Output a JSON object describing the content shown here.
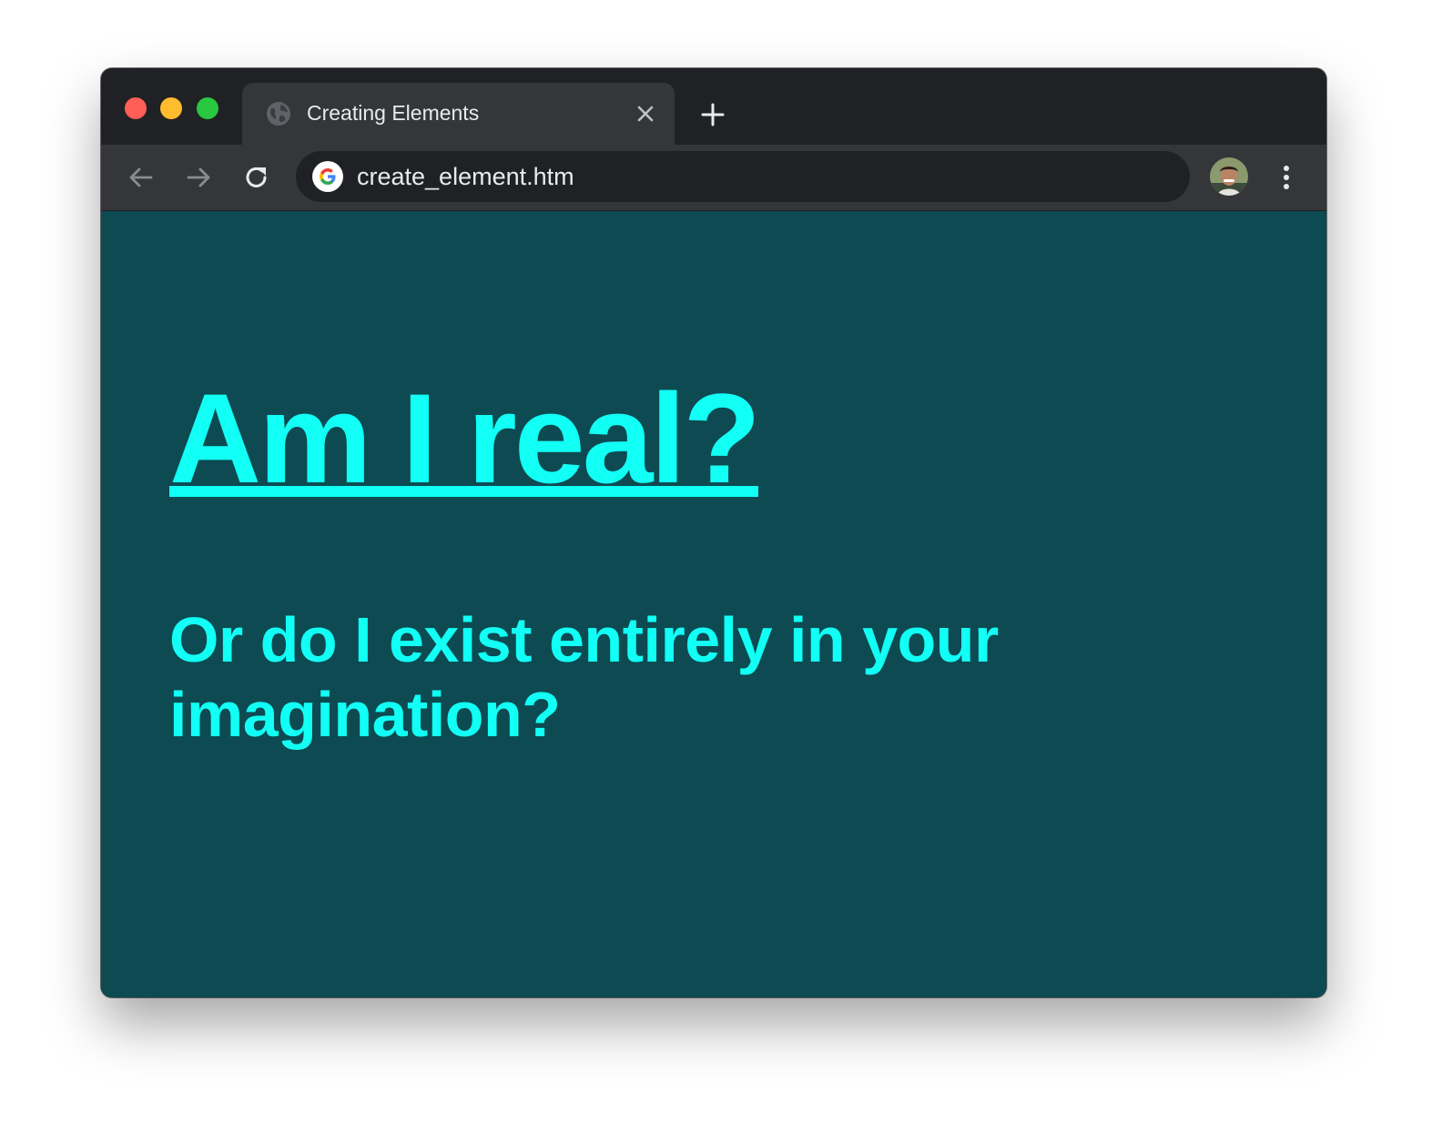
{
  "browser": {
    "tab": {
      "title": "Creating Elements",
      "favicon": "globe-icon"
    },
    "address_bar": {
      "url": "create_element.htm",
      "icon": "google-icon"
    },
    "icons": {
      "back": "arrow-left-icon",
      "forward": "arrow-right-icon",
      "reload": "reload-icon",
      "new_tab": "plus-icon",
      "close_tab": "close-icon",
      "menu": "kebab-menu-icon",
      "profile": "avatar"
    }
  },
  "page": {
    "heading": "Am I real?",
    "subheading": "Or do I exist entirely in your imagination?"
  },
  "colors": {
    "page_background": "#0d4a52",
    "text_accent": "#12fff6",
    "chrome_dark": "#202124",
    "chrome_toolbar": "#35363a"
  }
}
